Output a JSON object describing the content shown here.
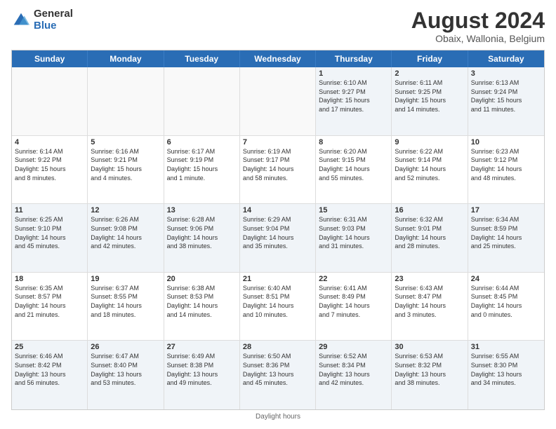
{
  "logo": {
    "general": "General",
    "blue": "Blue"
  },
  "title": "August 2024",
  "subtitle": "Obaix, Wallonia, Belgium",
  "header_days": [
    "Sunday",
    "Monday",
    "Tuesday",
    "Wednesday",
    "Thursday",
    "Friday",
    "Saturday"
  ],
  "weeks": [
    [
      {
        "day": "",
        "info": ""
      },
      {
        "day": "",
        "info": ""
      },
      {
        "day": "",
        "info": ""
      },
      {
        "day": "",
        "info": ""
      },
      {
        "day": "1",
        "info": "Sunrise: 6:10 AM\nSunset: 9:27 PM\nDaylight: 15 hours\nand 17 minutes."
      },
      {
        "day": "2",
        "info": "Sunrise: 6:11 AM\nSunset: 9:25 PM\nDaylight: 15 hours\nand 14 minutes."
      },
      {
        "day": "3",
        "info": "Sunrise: 6:13 AM\nSunset: 9:24 PM\nDaylight: 15 hours\nand 11 minutes."
      }
    ],
    [
      {
        "day": "4",
        "info": "Sunrise: 6:14 AM\nSunset: 9:22 PM\nDaylight: 15 hours\nand 8 minutes."
      },
      {
        "day": "5",
        "info": "Sunrise: 6:16 AM\nSunset: 9:21 PM\nDaylight: 15 hours\nand 4 minutes."
      },
      {
        "day": "6",
        "info": "Sunrise: 6:17 AM\nSunset: 9:19 PM\nDaylight: 15 hours\nand 1 minute."
      },
      {
        "day": "7",
        "info": "Sunrise: 6:19 AM\nSunset: 9:17 PM\nDaylight: 14 hours\nand 58 minutes."
      },
      {
        "day": "8",
        "info": "Sunrise: 6:20 AM\nSunset: 9:15 PM\nDaylight: 14 hours\nand 55 minutes."
      },
      {
        "day": "9",
        "info": "Sunrise: 6:22 AM\nSunset: 9:14 PM\nDaylight: 14 hours\nand 52 minutes."
      },
      {
        "day": "10",
        "info": "Sunrise: 6:23 AM\nSunset: 9:12 PM\nDaylight: 14 hours\nand 48 minutes."
      }
    ],
    [
      {
        "day": "11",
        "info": "Sunrise: 6:25 AM\nSunset: 9:10 PM\nDaylight: 14 hours\nand 45 minutes."
      },
      {
        "day": "12",
        "info": "Sunrise: 6:26 AM\nSunset: 9:08 PM\nDaylight: 14 hours\nand 42 minutes."
      },
      {
        "day": "13",
        "info": "Sunrise: 6:28 AM\nSunset: 9:06 PM\nDaylight: 14 hours\nand 38 minutes."
      },
      {
        "day": "14",
        "info": "Sunrise: 6:29 AM\nSunset: 9:04 PM\nDaylight: 14 hours\nand 35 minutes."
      },
      {
        "day": "15",
        "info": "Sunrise: 6:31 AM\nSunset: 9:03 PM\nDaylight: 14 hours\nand 31 minutes."
      },
      {
        "day": "16",
        "info": "Sunrise: 6:32 AM\nSunset: 9:01 PM\nDaylight: 14 hours\nand 28 minutes."
      },
      {
        "day": "17",
        "info": "Sunrise: 6:34 AM\nSunset: 8:59 PM\nDaylight: 14 hours\nand 25 minutes."
      }
    ],
    [
      {
        "day": "18",
        "info": "Sunrise: 6:35 AM\nSunset: 8:57 PM\nDaylight: 14 hours\nand 21 minutes."
      },
      {
        "day": "19",
        "info": "Sunrise: 6:37 AM\nSunset: 8:55 PM\nDaylight: 14 hours\nand 18 minutes."
      },
      {
        "day": "20",
        "info": "Sunrise: 6:38 AM\nSunset: 8:53 PM\nDaylight: 14 hours\nand 14 minutes."
      },
      {
        "day": "21",
        "info": "Sunrise: 6:40 AM\nSunset: 8:51 PM\nDaylight: 14 hours\nand 10 minutes."
      },
      {
        "day": "22",
        "info": "Sunrise: 6:41 AM\nSunset: 8:49 PM\nDaylight: 14 hours\nand 7 minutes."
      },
      {
        "day": "23",
        "info": "Sunrise: 6:43 AM\nSunset: 8:47 PM\nDaylight: 14 hours\nand 3 minutes."
      },
      {
        "day": "24",
        "info": "Sunrise: 6:44 AM\nSunset: 8:45 PM\nDaylight: 14 hours\nand 0 minutes."
      }
    ],
    [
      {
        "day": "25",
        "info": "Sunrise: 6:46 AM\nSunset: 8:42 PM\nDaylight: 13 hours\nand 56 minutes."
      },
      {
        "day": "26",
        "info": "Sunrise: 6:47 AM\nSunset: 8:40 PM\nDaylight: 13 hours\nand 53 minutes."
      },
      {
        "day": "27",
        "info": "Sunrise: 6:49 AM\nSunset: 8:38 PM\nDaylight: 13 hours\nand 49 minutes."
      },
      {
        "day": "28",
        "info": "Sunrise: 6:50 AM\nSunset: 8:36 PM\nDaylight: 13 hours\nand 45 minutes."
      },
      {
        "day": "29",
        "info": "Sunrise: 6:52 AM\nSunset: 8:34 PM\nDaylight: 13 hours\nand 42 minutes."
      },
      {
        "day": "30",
        "info": "Sunrise: 6:53 AM\nSunset: 8:32 PM\nDaylight: 13 hours\nand 38 minutes."
      },
      {
        "day": "31",
        "info": "Sunrise: 6:55 AM\nSunset: 8:30 PM\nDaylight: 13 hours\nand 34 minutes."
      }
    ]
  ],
  "footer": "Daylight hours"
}
